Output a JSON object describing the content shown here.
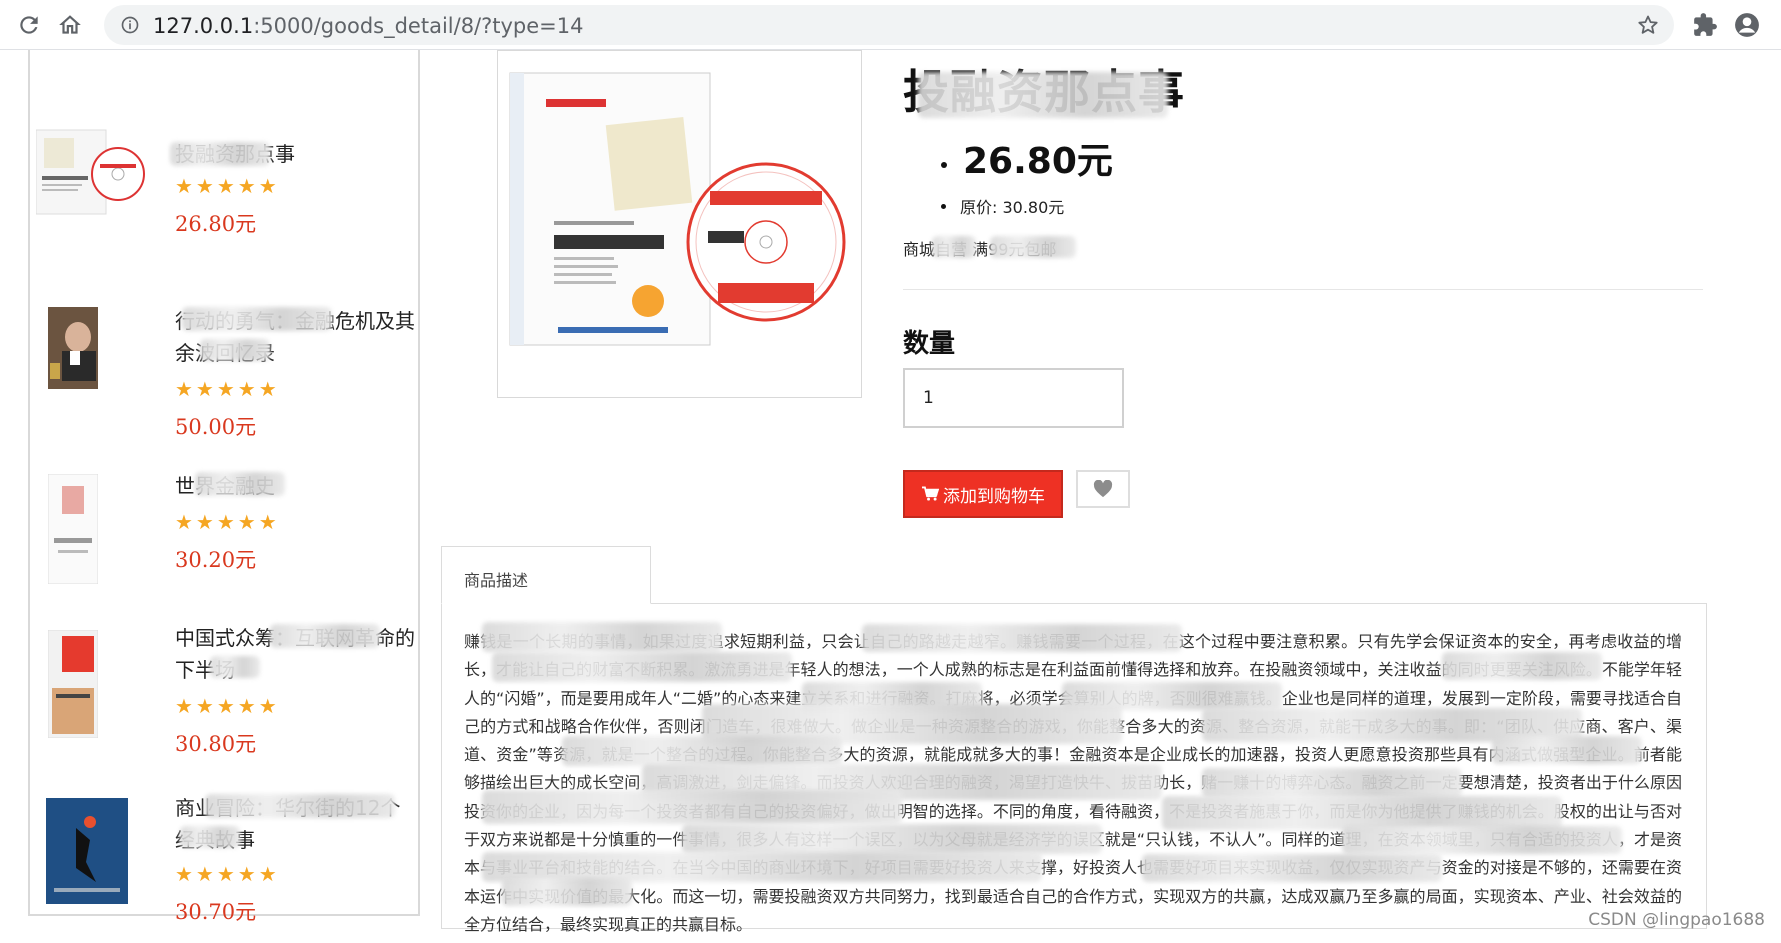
{
  "browser": {
    "url_host": "127.0.0.1",
    "url_path": ":5000/goods_detail/8/?type=14"
  },
  "sidebar": {
    "items": [
      {
        "title": "投融资那点事",
        "rating": "★★★★★",
        "price": "26.80元"
      },
      {
        "title": "行动的勇气：金融危机及其余波回忆录",
        "rating": "★★★★★",
        "price": "50.00元"
      },
      {
        "title": "世界金融史",
        "rating": "★★★★★",
        "price": "30.20元"
      },
      {
        "title": "中国式众筹：互联网革命的下半场",
        "rating": "★★★★★",
        "price": "30.80元"
      },
      {
        "title": "商业冒险：华尔街的12个经典故事",
        "rating": "★★★★★",
        "price": "30.70元"
      }
    ]
  },
  "product": {
    "title": "投融资那点事",
    "price": "26.80元",
    "original_price": "原价: 30.80元",
    "shop_info": "商城自营 满99元包邮",
    "quantity_label": "数量",
    "quantity_value": "1",
    "add_to_cart_label": "添加到购物车"
  },
  "description": {
    "tab_label": "商品描述",
    "text": "赚钱是一个长期的事情，如果过度追求短期利益，只会让自己的路越走越窄。赚钱需要一个过程，在这个过程中要注意积累。只有先学会保证资本的安全，再考虑收益的增长，才能让自己的财富不断积累。激流勇进是年轻人的想法，一个人成熟的标志是在利益面前懂得选择和放弃。在投融资领域中，关注收益的同时更要关注风险。不能学年轻人的“闪婚”，而是要用成年人“二婚”的心态来建立关系和进行融资。打麻将，必须学会算别人的牌，否则很难赢钱。企业也是同样的道理，发展到一定阶段，需要寻找适合自己的方式和战略合作伙伴，否则闭门造车，很难做大。做企业是一种资源整合的游戏，你能整合多大的资源、整合资源，就能干成多大的事。即：“团队、供应商、客户、渠道、资金”等资源，就是一个整合的过程。你能整合多大的资源，就能成就多大的事！金融资本是企业成长的加速器，投资人更愿意投资那些具有内涵式做强型企业。前者能够描绘出巨大的成长空间，高调激进，剑走偏锋。而投资人欢迎合理的融资，渴望打造快牛、拔苗助长，赌一赚十的博弈心态。融资之前一定要想清楚，投资者出于什么原因投资你的企业，因为每一个投资者都有自己的投资偏好，做出明智的选择。不同的角度，看待融资，不是投资者施惠于你，而是你为他提供了赚钱的机会。股权的出让与否对于双方来说都是十分慎重的一件事情，很多人有这样一个误区，以为父母就是经济学的误区就是“只认钱，不认人”。同样的道理，在资本领域里，只有合适的投资人，才是资本与事业平台和技能的结合。在当今中国的商业环境下，好项目需要好投资人来支撑，好投资人也需要好项目来实现收益，仅仅实现资产与资金的对接是不够的，还需要在资本运作中实现价值的最大化。而这一切，需要投融资双方共同努力，找到最适合自己的合作方式，实现双方的共赢，达成双赢乃至多赢的局面，实现资本、产业、社会效益的全方位结合，最终实现真正的共赢目标。"
  },
  "watermark": "CSDN @lingpao1688",
  "colors": {
    "cart_button": "#ee3124",
    "price_red": "#d9381e",
    "star_orange": "#f5a623"
  }
}
